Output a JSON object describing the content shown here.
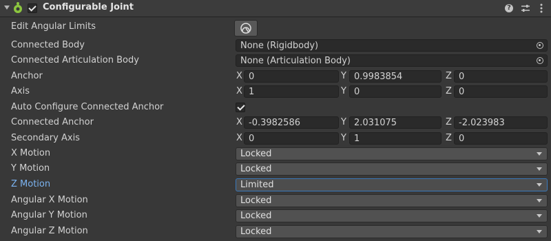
{
  "header": {
    "title": "Configurable Joint",
    "enabled": true,
    "icons": [
      "foldout-arrow",
      "configurable-joint-icon",
      "help-icon",
      "presets-icon",
      "more-menu-icon"
    ],
    "help_glyph": "?"
  },
  "rows": {
    "edit_angular_limits": {
      "label": "Edit Angular Limits",
      "button_icon": "edit-angular-limits-icon"
    },
    "connected_body": {
      "label": "Connected Body",
      "value": "None (Rigidbody)"
    },
    "connected_articulation_body": {
      "label": "Connected Articulation Body",
      "value": "None (Articulation Body)"
    },
    "anchor": {
      "label": "Anchor",
      "x": "0",
      "y": "0.9983854",
      "z": "0"
    },
    "axis": {
      "label": "Axis",
      "x": "1",
      "y": "0",
      "z": "0"
    },
    "auto_configure": {
      "label": "Auto Configure Connected Anchor",
      "checked": true
    },
    "connected_anchor": {
      "label": "Connected Anchor",
      "x": "-0.3982586",
      "y": "2.031075",
      "z": "-2.023983"
    },
    "secondary_axis": {
      "label": "Secondary Axis",
      "x": "0",
      "y": "1",
      "z": "0"
    },
    "x_motion": {
      "label": "X Motion",
      "value": "Locked"
    },
    "y_motion": {
      "label": "Y Motion",
      "value": "Locked"
    },
    "z_motion": {
      "label": "Z Motion",
      "value": "Limited"
    },
    "angular_x_motion": {
      "label": "Angular X Motion",
      "value": "Locked"
    },
    "angular_y_motion": {
      "label": "Angular Y Motion",
      "value": "Locked"
    },
    "angular_z_motion": {
      "label": "Angular Z Motion",
      "value": "Locked"
    }
  },
  "axis_letters": {
    "x": "X",
    "y": "Y",
    "z": "Z"
  },
  "colors": {
    "background": "#383838",
    "active_label": "#7bb3f0",
    "focus_border": "#3a79bb"
  }
}
